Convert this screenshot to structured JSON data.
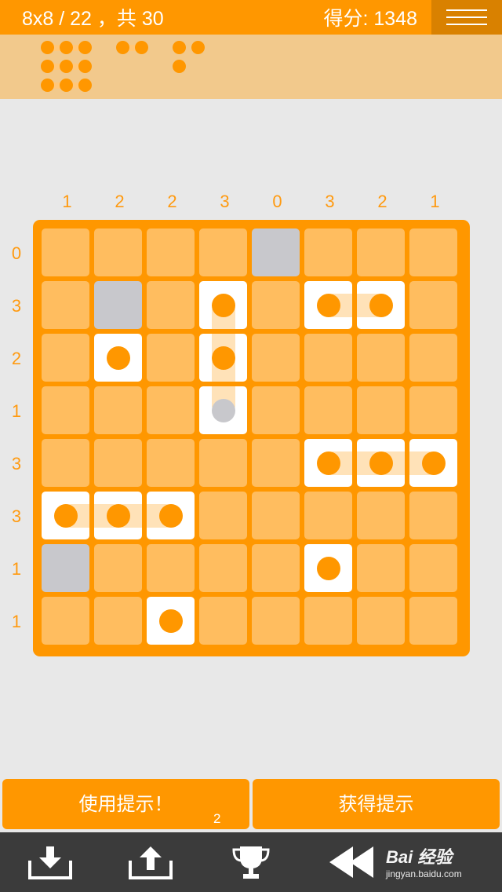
{
  "header": {
    "level_text": "8x8 / 22 ，共 30",
    "score_label": "得分: 1348",
    "menu_icon": "hamburger-menu-icon"
  },
  "board": {
    "size": 8,
    "column_hints": [
      "1",
      "2",
      "2",
      "3",
      "0",
      "3",
      "2",
      "1"
    ],
    "row_hints": [
      "0",
      "3",
      "2",
      "1",
      "3",
      "3",
      "1",
      "1"
    ],
    "cells": [
      [
        "empty",
        "empty",
        "empty",
        "empty",
        "water",
        "empty",
        "empty",
        "empty"
      ],
      [
        "empty",
        "water",
        "empty",
        "ship",
        "empty",
        "ship",
        "ship",
        "empty"
      ],
      [
        "empty",
        "ship",
        "empty",
        "ship",
        "empty",
        "empty",
        "empty",
        "empty"
      ],
      [
        "empty",
        "empty",
        "empty",
        "ship-grey",
        "empty",
        "empty",
        "empty",
        "empty"
      ],
      [
        "empty",
        "empty",
        "empty",
        "empty",
        "empty",
        "ship",
        "ship",
        "ship"
      ],
      [
        "ship",
        "ship",
        "ship",
        "empty",
        "empty",
        "empty",
        "empty",
        "empty"
      ],
      [
        "water",
        "empty",
        "empty",
        "empty",
        "empty",
        "ship",
        "empty",
        "empty"
      ],
      [
        "empty",
        "empty",
        "ship",
        "empty",
        "empty",
        "empty",
        "empty",
        "empty"
      ]
    ]
  },
  "buttons": {
    "use_hint": "使用提示！",
    "hint_count": "2",
    "get_hint": "获得提示"
  },
  "toolbar": {
    "items": [
      "download-icon",
      "upload-icon",
      "trophy-icon",
      "rewind-icon"
    ]
  },
  "watermark": {
    "brand": "Bai 经验",
    "url": "jingyan.baidu.com"
  },
  "colors": {
    "accent": "#ff9700",
    "cell": "#ffbd5f",
    "water": "#c8c8cc",
    "ship_cell": "#ffffff",
    "strip": "#f2c98c"
  }
}
